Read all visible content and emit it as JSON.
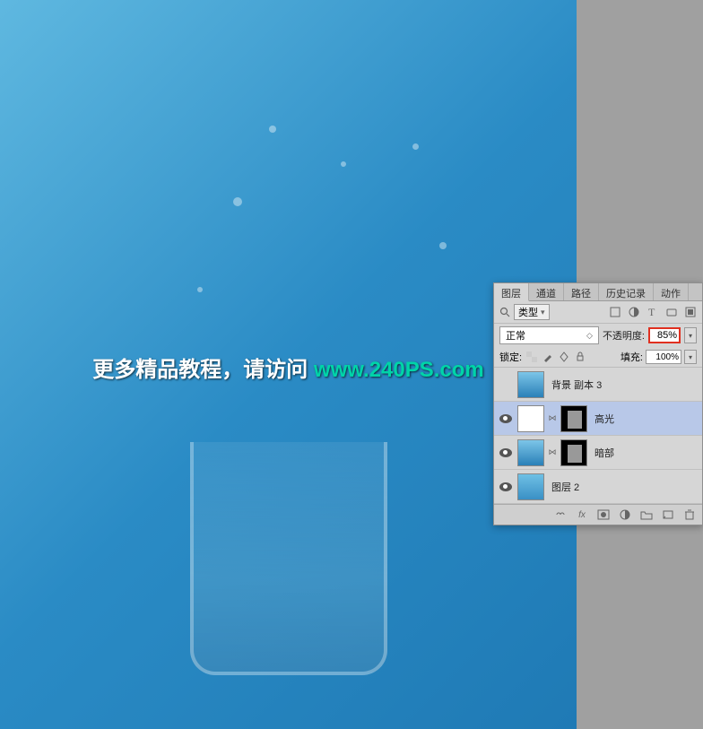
{
  "canvas": {
    "watermark_text1": "更多精品教程，请访问 ",
    "watermark_text2": "www.240PS.com"
  },
  "panel": {
    "tabs": [
      "图层",
      "通道",
      "路径",
      "历史记录",
      "动作"
    ],
    "active_tab": 0,
    "filter_label": "类型",
    "blend_mode": "正常",
    "opacity_label": "不透明度:",
    "opacity_value": "85%",
    "lock_label": "锁定:",
    "fill_label": "填充:",
    "fill_value": "100%",
    "layers": [
      {
        "visible": false,
        "name": "背景 副本 3",
        "has_mask": false,
        "thumb": "splash"
      },
      {
        "visible": true,
        "name": "高光",
        "has_mask": true,
        "thumb": "white",
        "mask": "black",
        "selected": true
      },
      {
        "visible": true,
        "name": "暗部",
        "has_mask": true,
        "thumb": "splash",
        "mask": "black"
      },
      {
        "visible": true,
        "name": "图层 2",
        "has_mask": false,
        "thumb": "blue"
      }
    ]
  }
}
